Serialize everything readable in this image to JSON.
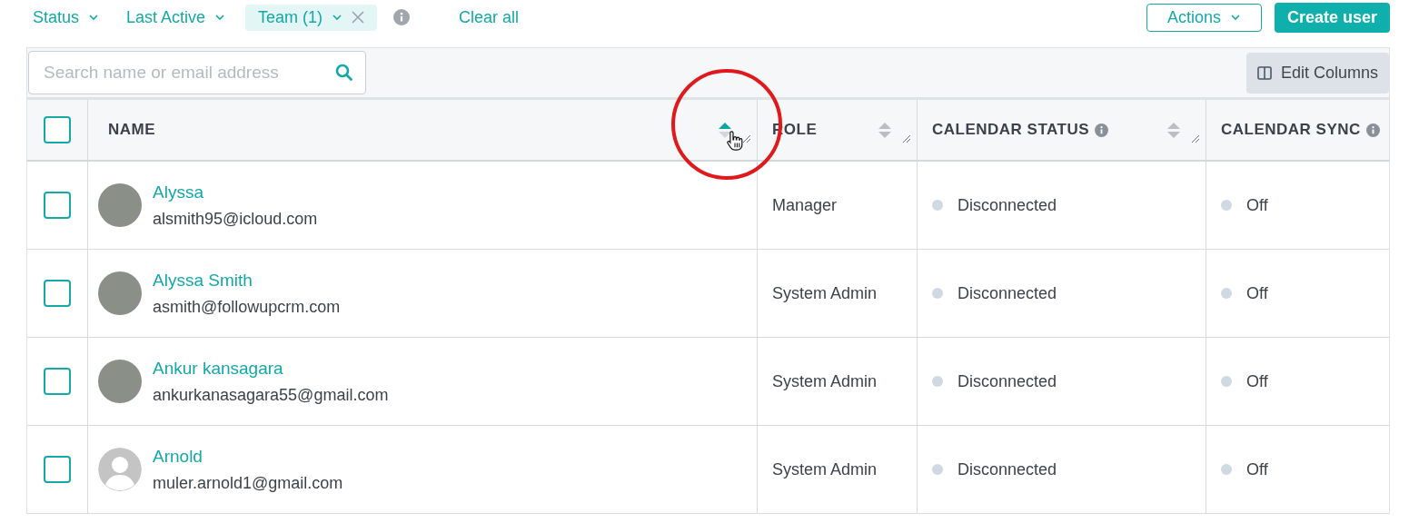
{
  "filters": [
    {
      "label": "Status",
      "kind": "dropdown"
    },
    {
      "label": "Last Active",
      "kind": "dropdown"
    },
    {
      "label": "Team (1)",
      "kind": "chip"
    }
  ],
  "clear_all": "Clear all",
  "actions": {
    "label": "Actions"
  },
  "create_button": "Create user",
  "search": {
    "placeholder": "Search name or email address"
  },
  "edit_columns": "Edit Columns",
  "table": {
    "select_all_checked": false,
    "columns": [
      {
        "label": "NAME",
        "sorted_ascending": true,
        "sortable": true,
        "info": false
      },
      {
        "label": "ROLE",
        "sorted_ascending": false,
        "sortable": true,
        "info": false
      },
      {
        "label": "CALENDAR STATUS",
        "sorted_ascending": false,
        "sortable": true,
        "info": true
      },
      {
        "label": "CALENDAR SYNC",
        "sortable": false,
        "info": true
      }
    ],
    "rows": [
      {
        "checked": false,
        "avatar": {
          "kind": "photo"
        },
        "name": "Alyssa",
        "email": "alsmith95@icloud.com",
        "role": "Manager",
        "calendar_status": "Disconnected",
        "calendar_sync": "Off"
      },
      {
        "checked": false,
        "avatar": {
          "kind": "photo"
        },
        "name": "Alyssa Smith",
        "email": "asmith@followupcrm.com",
        "role": "System Admin",
        "calendar_status": "Disconnected",
        "calendar_sync": "Off"
      },
      {
        "checked": false,
        "avatar": {
          "kind": "photo"
        },
        "name": "Ankur kansagara",
        "email": "ankurkanasagara55@gmail.com",
        "role": "System Admin",
        "calendar_status": "Disconnected",
        "calendar_sync": "Off"
      },
      {
        "checked": false,
        "avatar": {
          "kind": "default"
        },
        "name": "Arnold",
        "email": "muler.arnold1@gmail.com",
        "role": "System Admin",
        "calendar_status": "Disconnected",
        "calendar_sync": "Off"
      }
    ]
  }
}
